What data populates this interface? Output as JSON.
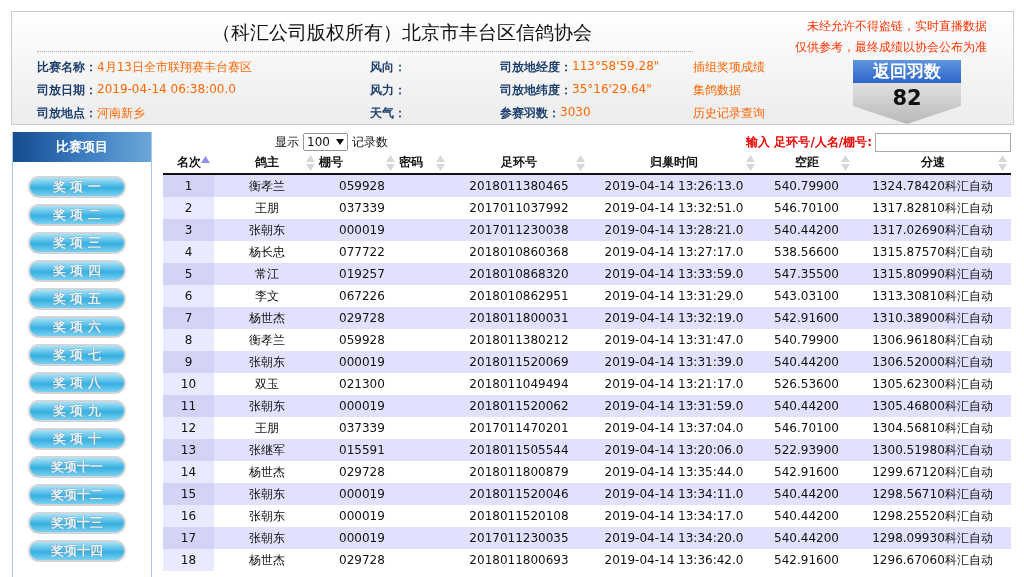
{
  "header": {
    "title": "（科汇公司版权所有）北京市丰台区信鸽协会",
    "info": [
      {
        "label": "比赛名称：",
        "value": "4月13日全市联翔赛丰台赛区"
      },
      {
        "label": "风向："
      },
      {
        "label": "司放地经度：",
        "value": "113°58'59.28\""
      },
      {
        "link": "插组奖项成绩"
      },
      {
        "label": "司放日期：",
        "value": "2019-04-14 06:38:00.0"
      },
      {
        "label": "风力："
      },
      {
        "label": "司放地纬度：",
        "value": "35°16'29.64\""
      },
      {
        "link": "集鸽数据"
      },
      {
        "label": "司放地点：",
        "value": "河南新乡"
      },
      {
        "label": "天气："
      },
      {
        "label": "参赛羽数：",
        "value": "3030"
      },
      {
        "link": "历史记录查询"
      }
    ],
    "notices": [
      "未经允许不得盗链，实时直播数据",
      "仅供参考，最终成绩以协会公布为准"
    ],
    "return_count": {
      "label": "返回羽数",
      "value": "82"
    }
  },
  "sidebar": {
    "title": "比赛项目",
    "items": [
      "奖 项 一",
      "奖 项 二",
      "奖 项 三",
      "奖 项 四",
      "奖 项 五",
      "奖 项 六",
      "奖 项 七",
      "奖 项 八",
      "奖 项 九",
      "奖 项 十",
      "奖项十一",
      "奖项十二",
      "奖项十三",
      "奖项十四"
    ]
  },
  "controls": {
    "show_label": "显示",
    "page_size": "100",
    "records_label": "记录数",
    "search_label": "输入 足环号/人名/棚号:"
  },
  "table": {
    "columns": [
      {
        "label": "名次",
        "sorted": true
      },
      {
        "label": "鸽主",
        "sorted": false
      },
      {
        "label": "棚号",
        "sorted": false
      },
      {
        "label": "密码",
        "sorted": false
      },
      {
        "label": "足环号",
        "sorted": false
      },
      {
        "label": "归巢时间",
        "sorted": false
      },
      {
        "label": "空距",
        "sorted": false
      },
      {
        "label": "分速",
        "sorted": false
      }
    ],
    "rows": [
      [
        "1",
        "衡孝兰",
        "059928",
        "",
        "2018011380465",
        "2019-04-14 13:26:13.0",
        "540.79900",
        "1324.78420科汇自动"
      ],
      [
        "2",
        "王朋",
        "037339",
        "",
        "2017011037992",
        "2019-04-14 13:32:51.0",
        "546.70100",
        "1317.82810科汇自动"
      ],
      [
        "3",
        "张朝东",
        "000019",
        "",
        "2017011230038",
        "2019-04-14 13:28:21.0",
        "540.44200",
        "1317.02690科汇自动"
      ],
      [
        "4",
        "杨长忠",
        "077722",
        "",
        "2018010860368",
        "2019-04-14 13:27:17.0",
        "538.56600",
        "1315.87570科汇自动"
      ],
      [
        "5",
        "常江",
        "019257",
        "",
        "2018010868320",
        "2019-04-14 13:33:59.0",
        "547.35500",
        "1315.80990科汇自动"
      ],
      [
        "6",
        "李文",
        "067226",
        "",
        "2018010862951",
        "2019-04-14 13:31:29.0",
        "543.03100",
        "1313.30810科汇自动"
      ],
      [
        "7",
        "杨世杰",
        "029728",
        "",
        "2018011800031",
        "2019-04-14 13:32:19.0",
        "542.91600",
        "1310.38900科汇自动"
      ],
      [
        "8",
        "衡孝兰",
        "059928",
        "",
        "2018011380212",
        "2019-04-14 13:31:47.0",
        "540.79900",
        "1306.96180科汇自动"
      ],
      [
        "9",
        "张朝东",
        "000019",
        "",
        "2018011520069",
        "2019-04-14 13:31:39.0",
        "540.44200",
        "1306.52000科汇自动"
      ],
      [
        "10",
        "双玉",
        "021300",
        "",
        "2018011049494",
        "2019-04-14 13:21:17.0",
        "526.53600",
        "1305.62300科汇自动"
      ],
      [
        "11",
        "张朝东",
        "000019",
        "",
        "2018011520062",
        "2019-04-14 13:31:59.0",
        "540.44200",
        "1305.46800科汇自动"
      ],
      [
        "12",
        "王朋",
        "037339",
        "",
        "2017011470201",
        "2019-04-14 13:37:04.0",
        "546.70100",
        "1304.56810科汇自动"
      ],
      [
        "13",
        "张继军",
        "015591",
        "",
        "2018011505544",
        "2019-04-14 13:20:06.0",
        "522.93900",
        "1300.51980科汇自动"
      ],
      [
        "14",
        "杨世杰",
        "029728",
        "",
        "2018011800879",
        "2019-04-14 13:35:44.0",
        "542.91600",
        "1299.67120科汇自动"
      ],
      [
        "15",
        "张朝东",
        "000019",
        "",
        "2018011520046",
        "2019-04-14 13:34:11.0",
        "540.44200",
        "1298.56710科汇自动"
      ],
      [
        "16",
        "张朝东",
        "000019",
        "",
        "2018011520108",
        "2019-04-14 13:34:17.0",
        "540.44200",
        "1298.25520科汇自动"
      ],
      [
        "17",
        "张朝东",
        "000019",
        "",
        "2017011230035",
        "2019-04-14 13:34:20.0",
        "540.44200",
        "1298.09930科汇自动"
      ],
      [
        "18",
        "杨世杰",
        "029728",
        "",
        "2018011800693",
        "2019-04-14 13:36:42.0",
        "542.91600",
        "1296.67060科汇自动"
      ]
    ]
  }
}
